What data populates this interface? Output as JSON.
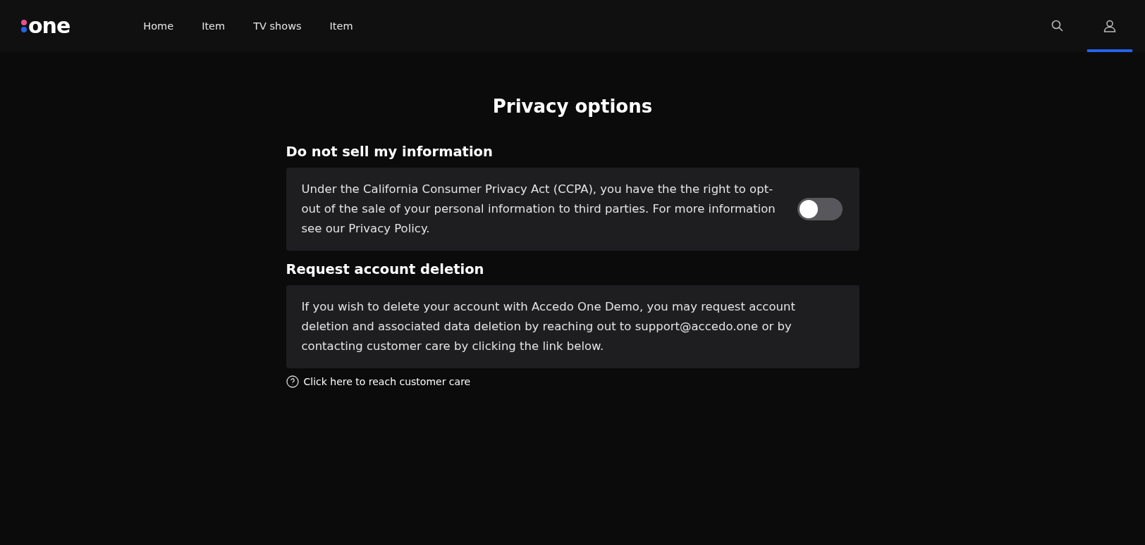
{
  "logo": {
    "text": "one"
  },
  "nav": [
    {
      "label": "Home"
    },
    {
      "label": "Item"
    },
    {
      "label": "TV shows"
    },
    {
      "label": "Item"
    }
  ],
  "header_icons": [
    {
      "kind": "search",
      "selected": false
    },
    {
      "kind": "account",
      "selected": true
    }
  ],
  "page_title": "Privacy options",
  "sections": [
    {
      "heading": "Do not sell my information",
      "text": "Under the California Consumer Privacy Act (CCPA), you have the the right to opt-out of the sale of your personal information to third parties. For more information see our Privacy Policy.",
      "toggle": {
        "on": false
      }
    },
    {
      "heading": "Request account deletion",
      "text": "If you wish to delete your account with Accedo One Demo, you may request account deletion and associated data deletion by reaching out to support@accedo.one or by contacting customer care by clicking the link below.",
      "link": "Click here to reach customer care"
    }
  ]
}
